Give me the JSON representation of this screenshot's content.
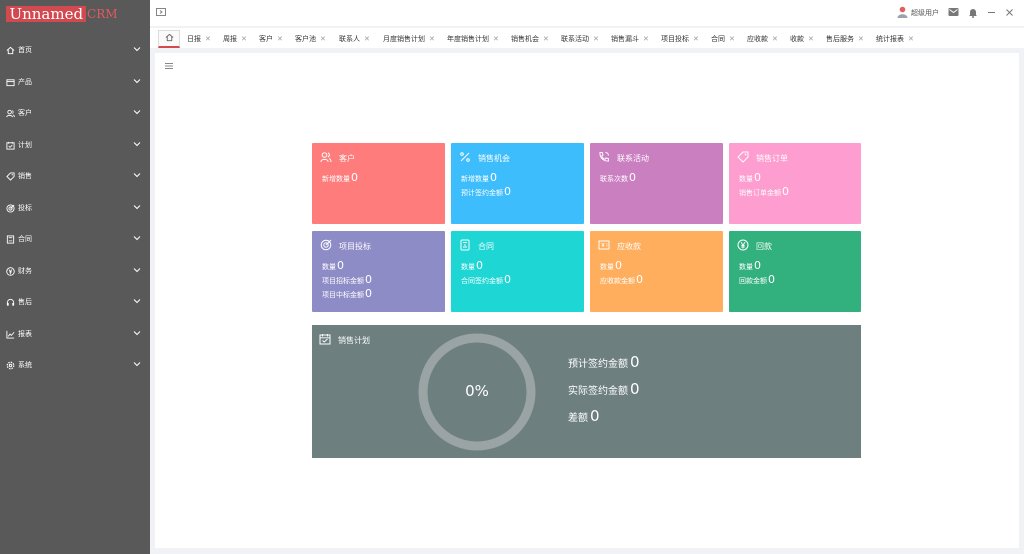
{
  "app": {
    "logo_main": "Unnamed",
    "logo_sub": "CRM"
  },
  "user": {
    "name": "超级用户"
  },
  "sidebar": {
    "items": [
      {
        "label": "首页",
        "icon": "home-icon"
      },
      {
        "label": "产品",
        "icon": "product-icon"
      },
      {
        "label": "客户",
        "icon": "customers-icon"
      },
      {
        "label": "计划",
        "icon": "plan-icon"
      },
      {
        "label": "销售",
        "icon": "tag-icon"
      },
      {
        "label": "投标",
        "icon": "target-icon"
      },
      {
        "label": "合同",
        "icon": "contract-icon"
      },
      {
        "label": "财务",
        "icon": "yen-icon"
      },
      {
        "label": "售后",
        "icon": "headset-icon"
      },
      {
        "label": "报表",
        "icon": "chart-icon"
      },
      {
        "label": "系统",
        "icon": "gear-icon"
      }
    ]
  },
  "tabs": [
    {
      "label": "日报"
    },
    {
      "label": "周报"
    },
    {
      "label": "客户"
    },
    {
      "label": "客户池"
    },
    {
      "label": "联系人"
    },
    {
      "label": "月度销售计划"
    },
    {
      "label": "年度销售计划"
    },
    {
      "label": "销售机会"
    },
    {
      "label": "联系活动"
    },
    {
      "label": "销售漏斗"
    },
    {
      "label": "项目投标"
    },
    {
      "label": "合同"
    },
    {
      "label": "应收款"
    },
    {
      "label": "收款"
    },
    {
      "label": "售后服务"
    },
    {
      "label": "统计报表"
    }
  ],
  "cards": {
    "customer": {
      "title": "客户",
      "rows": [
        {
          "label": "新增数量",
          "value": "0"
        }
      ],
      "color": "#fe7d7c"
    },
    "opportunity": {
      "title": "销售机会",
      "rows": [
        {
          "label": "新增数量",
          "value": "0"
        },
        {
          "label": "预计签约金额",
          "value": "0"
        }
      ],
      "color": "#3ebdfd"
    },
    "activity": {
      "title": "联系活动",
      "rows": [
        {
          "label": "联系次数",
          "value": "0"
        }
      ],
      "color": "#ca7fc0"
    },
    "order": {
      "title": "销售订单",
      "rows": [
        {
          "label": "数量",
          "value": "0"
        },
        {
          "label": "销售订单金额",
          "value": "0"
        }
      ],
      "color": "#fe9dcf"
    },
    "bidding": {
      "title": "项目投标",
      "rows": [
        {
          "label": "数量",
          "value": "0"
        },
        {
          "label": "项目招标金额",
          "value": "0"
        },
        {
          "label": "项目中标金额",
          "value": "0"
        }
      ],
      "color": "#8e8cc6"
    },
    "contract": {
      "title": "合同",
      "rows": [
        {
          "label": "数量",
          "value": "0"
        },
        {
          "label": "合同签约金额",
          "value": "0"
        }
      ],
      "color": "#1ed6d4"
    },
    "receivable": {
      "title": "应收款",
      "rows": [
        {
          "label": "数量",
          "value": "0"
        },
        {
          "label": "应收款金额",
          "value": "0"
        }
      ],
      "color": "#feae5d"
    },
    "payment": {
      "title": "回款",
      "rows": [
        {
          "label": "数量",
          "value": "0"
        },
        {
          "label": "回款金额",
          "value": "0"
        }
      ],
      "color": "#32b07e"
    }
  },
  "sales_plan": {
    "title": "销售计划",
    "percent_label": "0%",
    "progress_fraction": 0,
    "rows": [
      {
        "label": "预计签约金额",
        "value": "0"
      },
      {
        "label": "实际签约金额",
        "value": "0"
      },
      {
        "label": "差额",
        "value": "0"
      }
    ],
    "color": "#6e7f80"
  },
  "colors": {
    "accent": "#d2494f",
    "sidebar": "#595959"
  }
}
